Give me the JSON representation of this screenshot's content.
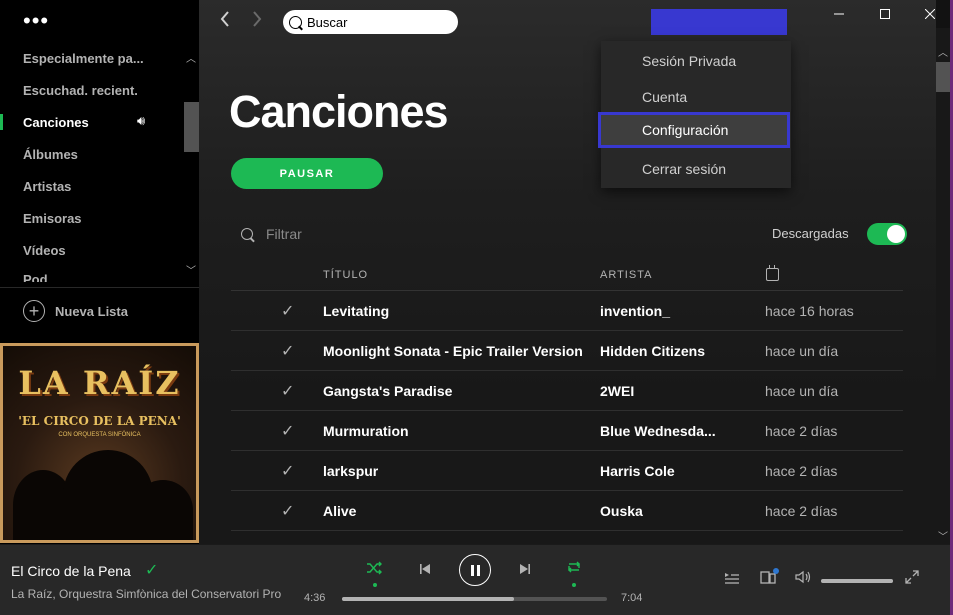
{
  "sidebar": {
    "more_label": "•••",
    "items": [
      {
        "label": "Especialmente pa..."
      },
      {
        "label": "Escuchad. recient."
      },
      {
        "label": "Canciones"
      },
      {
        "label": "Álbumes"
      },
      {
        "label": "Artistas"
      },
      {
        "label": "Emisoras"
      },
      {
        "label": "Vídeos"
      },
      {
        "label": "Pod..."
      }
    ],
    "active_item": "Canciones",
    "new_playlist_label": "Nueva Lista"
  },
  "album_art": {
    "title": "LA RAÍZ",
    "subtitle": "'EL CIRCO DE LA PENA'",
    "subsubtitle": "CON ORQUESTA SINFÓNICA"
  },
  "header": {
    "back_icon": "chevron-left-icon",
    "forward_icon": "chevron-right-icon",
    "search_value": "Buscar",
    "user_button_color": "#3838d0"
  },
  "menu": {
    "items": [
      {
        "label": "Sesión Privada"
      },
      {
        "label": "Cuenta"
      },
      {
        "label": "Configuración"
      },
      {
        "label": "Cerrar sesión"
      }
    ],
    "highlighted_item": "Configuración",
    "highlight_color": "#3838d0"
  },
  "main": {
    "title": "Canciones",
    "play_label": "PAUSAR",
    "filter_placeholder": "Filtrar",
    "downloaded_label": "Descargadas",
    "downloaded_on": true,
    "columns": {
      "title": "TÍTULO",
      "artist": "ARTISTA"
    },
    "tracks": [
      {
        "title": "Levitating",
        "artist": "invention_",
        "added": "hace 16 horas"
      },
      {
        "title": "Moonlight Sonata - Epic Trailer Version",
        "artist": "Hidden Citizens",
        "added": "hace un día"
      },
      {
        "title": "Gangsta's Paradise",
        "artist": "2WEI",
        "added": "hace un día"
      },
      {
        "title": "Murmuration",
        "artist": "Blue Wednesda...",
        "added": "hace 2 días"
      },
      {
        "title": "larkspur",
        "artist": "Harris Cole",
        "added": "hace 2 días"
      },
      {
        "title": "Alive",
        "artist": "Ouska",
        "added": "hace 2 días"
      }
    ]
  },
  "player": {
    "title": "El Circo de la Pena",
    "artist": "La Raíz, Orquestra Simfònica del Conservatori Pro",
    "elapsed": "4:36",
    "total": "7:04",
    "progress_fraction": 0.65,
    "volume_fraction": 1.0,
    "shuffle_on": true,
    "repeat_on": true
  },
  "colors": {
    "accent": "#1db954",
    "background": "#121212",
    "sidebar": "#000000",
    "player": "#282828"
  }
}
